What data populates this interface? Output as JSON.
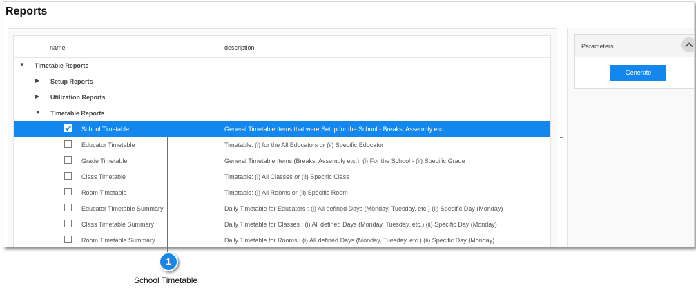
{
  "page": {
    "title": "Reports"
  },
  "table": {
    "columns": {
      "name": "name",
      "description": "description"
    },
    "tree": [
      {
        "label": "Timetable Reports",
        "expanded": true
      },
      {
        "label": "Setup Reports",
        "expanded": false
      },
      {
        "label": "Utilization Reports",
        "expanded": false
      },
      {
        "label": "Timetable Reports",
        "expanded": true
      }
    ],
    "items": [
      {
        "name": "School Timetable",
        "description": "General Timetable Items that were Setup for the School - Breaks, Assembly etc",
        "checked": true,
        "selected": true
      },
      {
        "name": "Educator Timetable",
        "description": "Timetable: (i) for the All Educators or (ii) Specific Educator",
        "checked": false,
        "selected": false
      },
      {
        "name": "Grade Timetable",
        "description": "General Timetable Items (Breaks, Assembly etc.). (i) For the School - (ii) Specific Grade",
        "checked": false,
        "selected": false
      },
      {
        "name": "Class Timetable",
        "description": "Timetable: (i) All Classes or (ii) Specific Class",
        "checked": false,
        "selected": false
      },
      {
        "name": "Room Timetable",
        "description": "Timetable: (i) All Rooms or (ii) Specific Room",
        "checked": false,
        "selected": false
      },
      {
        "name": "Educator Timetable Summary",
        "description": "Daily Timetable for Educators : (i) All defined Days (Monday, Tuesday, etc.) (ii) Specific Day (Monday)",
        "checked": false,
        "selected": false
      },
      {
        "name": "Class Timetable Summary",
        "description": "Daily Timetable for Classes : (i) All defined Days (Monday, Tuesday, etc.) (ii) Specific Day (Monday)",
        "checked": false,
        "selected": false
      },
      {
        "name": "Room Timetable Summary",
        "description": "Daily Timetable for Rooms : (i) All defined Days (Monday, Tuesday, etc.) (ii) Specific Day (Monday)",
        "checked": false,
        "selected": false
      }
    ]
  },
  "parameters": {
    "title": "Parameters",
    "generate_label": "Generate"
  },
  "callout": {
    "number": "1",
    "caption": "School Timetable"
  },
  "colors": {
    "accent": "#1387ee",
    "selected_text": "#ffffff"
  },
  "icons": {
    "expanded": "caret-down-icon",
    "collapsed": "caret-right-icon",
    "check": "checkmark-icon",
    "collapse": "chevron-up-icon",
    "splitter": "drag-handle-icon"
  }
}
